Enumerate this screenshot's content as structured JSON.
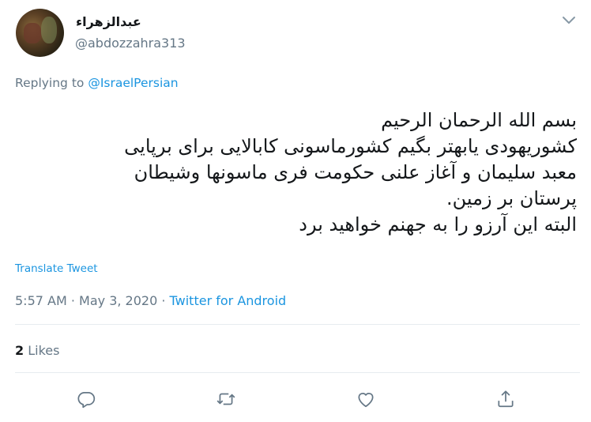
{
  "author": {
    "display_name": "عبدالزهراء",
    "handle": "@abdozzahra313"
  },
  "reply": {
    "prefix": "Replying to ",
    "mention": "@IsraelPersian"
  },
  "tweet": {
    "lines": [
      "بسم الله الرحمان الرحیم",
      "کشوریهودی یابهتر بگیم کشورماسونی کابالایی برای برپایی",
      "معبد سلیمان و آغاز علنی حکومت فری ماسونها وشیطان",
      "پرستان بر زمین.",
      "البته این آرزو را به جهنم خواهید برد"
    ]
  },
  "translate_label": "Translate Tweet",
  "meta": {
    "time_date": "5:57 AM · May 3, 2020 · ",
    "source": "Twitter for Android"
  },
  "likes": {
    "count": "2",
    "label": " Likes"
  },
  "colors": {
    "link": "#1b95e0",
    "secondary": "#657786",
    "divider": "#e6ecf0"
  },
  "icons": [
    "chevron-down-icon",
    "reply-icon",
    "retweet-icon",
    "like-icon",
    "share-icon"
  ]
}
